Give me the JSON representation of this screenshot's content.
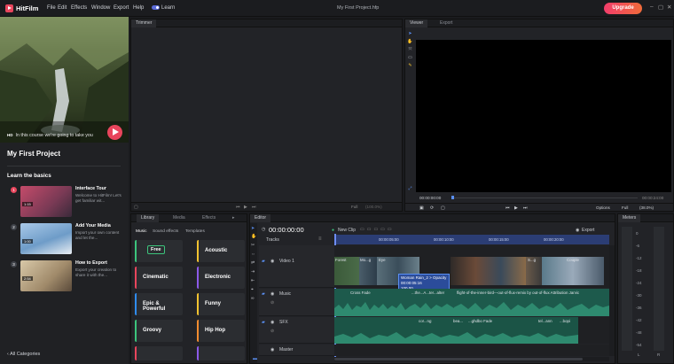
{
  "app": {
    "name": "HitFilm",
    "menus": [
      "File",
      "Edit",
      "Effects",
      "Window",
      "Export",
      "Help"
    ],
    "learn_toggle_label": "Learn",
    "project_file": "My First Project.hfp",
    "upgrade_label": "Upgrade",
    "window_controls": [
      "–",
      "▢",
      "✕"
    ]
  },
  "learn": {
    "hero_caption": "In this course we're going to take you",
    "course_title": "My First Project",
    "section_title": "Learn the basics",
    "lessons": [
      {
        "num": "1",
        "title": "Interface Tour",
        "desc": "Welcome to HitFilm! Let's get familiar wit...",
        "duration": "1:15"
      },
      {
        "num": "2",
        "title": "Add Your Media",
        "desc": "Import your own content and let the...",
        "duration": "1:00"
      },
      {
        "num": "3",
        "title": "How to Export",
        "desc": "Export your creation to share it with the...",
        "duration": "2:54"
      }
    ],
    "all_categories": "All Categories"
  },
  "trimmer": {
    "tab": "Trimmer",
    "full_label": "Full",
    "zoom_label": "(100.0%)"
  },
  "viewer": {
    "tabs": [
      "Viewer",
      "Export"
    ],
    "timecode_left": "00:00:00:00",
    "timecode_right": "00:00:24:00",
    "options_label": "Options",
    "full_label": "Full",
    "zoom_label": "(38.0%)"
  },
  "library": {
    "tabs": [
      "Library",
      "Media",
      "Effects"
    ],
    "categories": [
      "Music",
      "Sound effects",
      "Templates"
    ],
    "tiles": [
      {
        "label": "Free",
        "color": "#3cc47c"
      },
      {
        "label": "Acoustic",
        "color": "#f2c230"
      },
      {
        "label": "Cinematic",
        "color": "#e8455c"
      },
      {
        "label": "Electronic",
        "color": "#8c5ae8"
      },
      {
        "label": "Epic & Powerful",
        "color": "#2f8cf2"
      },
      {
        "label": "Funny",
        "color": "#f2c230"
      },
      {
        "label": "Groovy",
        "color": "#3cc47c"
      },
      {
        "label": "Hip Hop",
        "color": "#f28c2f"
      }
    ]
  },
  "editor": {
    "tab": "Editor",
    "timecode": "00:00:00:00",
    "new_clip": "New Clip",
    "export_label": "Export",
    "tracks_label": "Tracks",
    "ruler_marks": [
      "00:00:05:00",
      "00:00:10:00",
      "00:00:15:00",
      "00:00:20:00"
    ],
    "tracks": [
      "Video 1",
      "Music",
      "SFX",
      "Master"
    ],
    "video_clips": [
      "Forest",
      "Mo...g",
      "Eye",
      "S...g",
      "Couple"
    ],
    "tooltip": [
      "Woman Rain_2 > Opacity",
      "00:00:05:16",
      "100.00"
    ],
    "music_clips": [
      "Cross Fade",
      "...the...A...ter...alter",
      "flight-of-the-inner-bird---out-of-flux-remix by out-of-flux Attribution Jarvic"
    ],
    "sfx_clips": [
      "cor...ng",
      "bea...",
      "...ghdbo Fade",
      "tel...ann",
      "...bopi"
    ]
  },
  "meters": {
    "tab": "Meters",
    "scale": [
      "0",
      "-6",
      "-12",
      "-18",
      "-24",
      "-30",
      "-36",
      "-42",
      "-48",
      "-54"
    ],
    "channels": [
      "L",
      "R"
    ]
  },
  "colors": {
    "accent": "#e8455c",
    "timeline_blue": "#4c6fd8",
    "audio_green": "#1d5a4c"
  }
}
